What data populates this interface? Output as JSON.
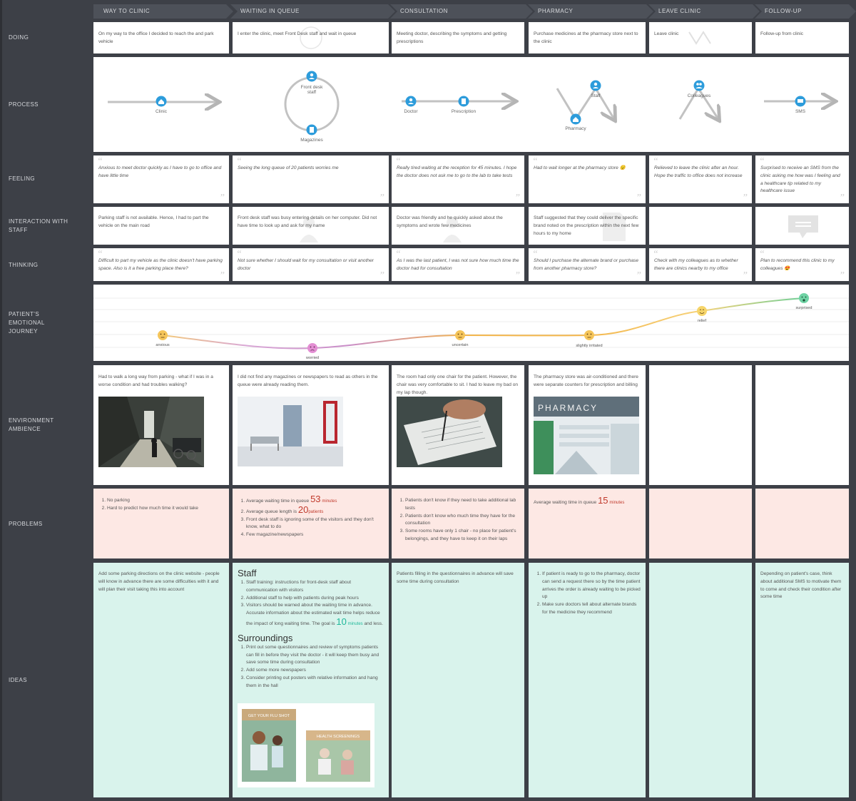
{
  "stages": [
    "WAY TO CLINIC",
    "WAITING IN QUEUE",
    "CONSULTATION",
    "PHARMACY",
    "LEAVE CLINIC",
    "FOLLOW-UP"
  ],
  "row_labels": {
    "doing": "DOING",
    "process": "PROCESS",
    "feeling": "FEELING",
    "interaction": "INTERACTION WITH STAFF",
    "thinking": "THINKING",
    "emotional": "PATIENT'S EMOTIONAL JOURNEY",
    "environment": "ENVIRONMENT AMBIENCE",
    "problems": "PROBLEMS",
    "ideas": "IDEAS"
  },
  "doing": [
    "On my way to the office I decided to reach the and park vehicle",
    "I enter the clinic, meet Front Desk staff and wait in queue",
    "Meeting doctor, describing the symptoms and getting prescriptions",
    "Purchase medicines at the pharmacy store next to the clinic",
    "Leave clinic",
    "Follow-up from clinic"
  ],
  "process_labels": {
    "clinic": "Clinic",
    "front_desk": "Front desk staff",
    "magazines": "Magazines",
    "doctor": "Doctor",
    "prescription": "Prescription",
    "staff": "Staff",
    "pharmacy": "Pharmacy",
    "colleagues": "Colleagues",
    "sms": "SMS"
  },
  "feeling": [
    "Anxious to meet doctor quickly as I have to go to office and have little time",
    "Seeing the long queue of 20 patients worries me",
    "Really tired waiting at the reception for 45 minutes. I hope the doctor does not ask me to go to the lab to take tests",
    "Had to wait longer at the pharmacy store 😟",
    "Relieved to leave the clinic after an hour. Hope the traffic to office does not increase",
    "Surprised to receive an SMS from the clinic asking me how was I feeling and a healthcare tip related to my healthcare issue"
  ],
  "interaction": [
    "Parking staff is not available. Hence, I had to part the vehicle on the main road",
    "Front desk staff was busy entering details on her computer. Did not have time to look up and ask for my name",
    "Doctor was friendly and he quickly asked about the symptoms and wrote few medicines",
    "Staff suggested that they could deliver the specific brand noted on the prescription within the next few hours to my home",
    "",
    ""
  ],
  "thinking": [
    "Difficult to part my vehicle as the clinic doesn't have parking space. Also is it a free parking place there?",
    "Not sure whether I should wait for my consultation or visit another doctor",
    "As I was the last patient, I was not sure how much time the doctor had for consultation",
    "Should I purchase the alternate brand or purchase from another pharmacy store?",
    "Check with my colleagues as to whether there are clinics nearby to my office",
    "Plan to recommend this clinic to my colleagues 😍"
  ],
  "emotions": {
    "anxious": "anxious",
    "worried": "worried",
    "uncertain": "uncertain",
    "irritated": "slightly irritated",
    "relief": "relief",
    "surprised": "surprised"
  },
  "environment": [
    "Had to walk a long way from parking - what if I was in a worse condition and had troubles walking?",
    "I did not find any magazines or newspapers to read as others in the queue were already reading them.",
    "The room had only one chair for the patient. However, the chair was very comfortable to sit. I had to leave my bad on my lap though.",
    "The pharmacy store was air-conditioned and there were separate counters for prescription and billing",
    "",
    ""
  ],
  "pharmacy_sign": "PHARMACY",
  "problems": {
    "way": [
      "No parking",
      "Hard to predict how much time it would take"
    ],
    "queue": {
      "wait_pre": "Average waiting time in queue",
      "wait_num": "53",
      "wait_unit": "minutes",
      "len_pre": "Average queue length is",
      "len_num": "20",
      "len_unit": "patients",
      "item3": "Front desk staff is ignoring some of the visitors and they don't know, what to do",
      "item4": "Few magazine/newspapers"
    },
    "consultation": [
      "Patients don't know if they need to take additional lab tests",
      "Patients don't know who much time they have for the consultation",
      "Some rooms have only 1 chair - no place for patient's belongings, and they have to keep it on their laps"
    ],
    "pharmacy": {
      "pre": "Average waiting time in queue",
      "num": "15",
      "unit": "minutes"
    }
  },
  "ideas": {
    "way": "Add some parking directions on the clinic website - people will know in advance there are some difficulties with it and will plan their visit taking this into account",
    "staff_heading": "Staff",
    "staff_items": [
      "Staff training: instructions for front-desk staff about communication with visitors",
      "Additional staff to help with patients during peak hours"
    ],
    "staff_item3_pre": "Visitors should be warned about the waiting time in advance. Accurate information about the estimated wait time helps reduce the impact of long waiting time. The goal is",
    "staff_goal_num": "10",
    "staff_goal_unit": "minutes",
    "staff_goal_post": "and less.",
    "surroundings_heading": "Surroundings",
    "surroundings_items": [
      "Print out some questionnaires and review of symptoms patients can fill in before they visit the doctor - it will keep them busy and save some time during consultation",
      "Add some more newspapers",
      "Consider printing out posters with relative information and hang them in the hall"
    ],
    "poster1": "GET YOUR FLU SHOT",
    "poster2": "HEALTH SCREENINGS",
    "consultation": "Patients filling in the questionnaires in advance will save some time during consultation",
    "pharmacy": [
      "If patient is ready to go to the pharmacy, doctor can send a request there so by the time patient arrives the order is already waiting to be picked up",
      "Make sure doctors tell about alternate brands for the medicine they recommend"
    ],
    "leave": "",
    "followup": "Depending on patient's case, think about additional SMS to motivate them to come and check their condition after some time"
  },
  "colors": {
    "accent": "#2d9cdb",
    "problem_bg": "#fde8e4",
    "idea_bg": "#d9f3ec",
    "board": "#3d4047"
  }
}
